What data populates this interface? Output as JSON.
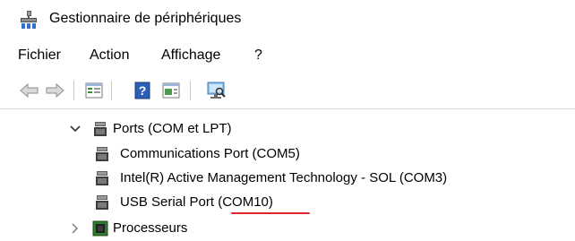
{
  "window": {
    "title": "Gestionnaire de périphériques",
    "app_icon": "device-manager-icon"
  },
  "menu": {
    "items": [
      "Fichier",
      "Action",
      "Affichage",
      "?"
    ]
  },
  "toolbar": {
    "buttons": [
      "back-arrow-icon",
      "forward-arrow-icon",
      "properties-icon",
      "help-icon",
      "update-driver-icon",
      "scan-hardware-icon"
    ]
  },
  "tree": {
    "ports_label": "Ports (COM et LPT)",
    "ports_children": [
      "Communications Port (COM5)",
      "Intel(R) Active Management Technology - SOL (COM3)",
      "USB Serial Port (COM10)"
    ],
    "processors_label": "Processeurs"
  },
  "colors": {
    "annotation": "#e0262a",
    "accent": "#1e6fd9"
  }
}
